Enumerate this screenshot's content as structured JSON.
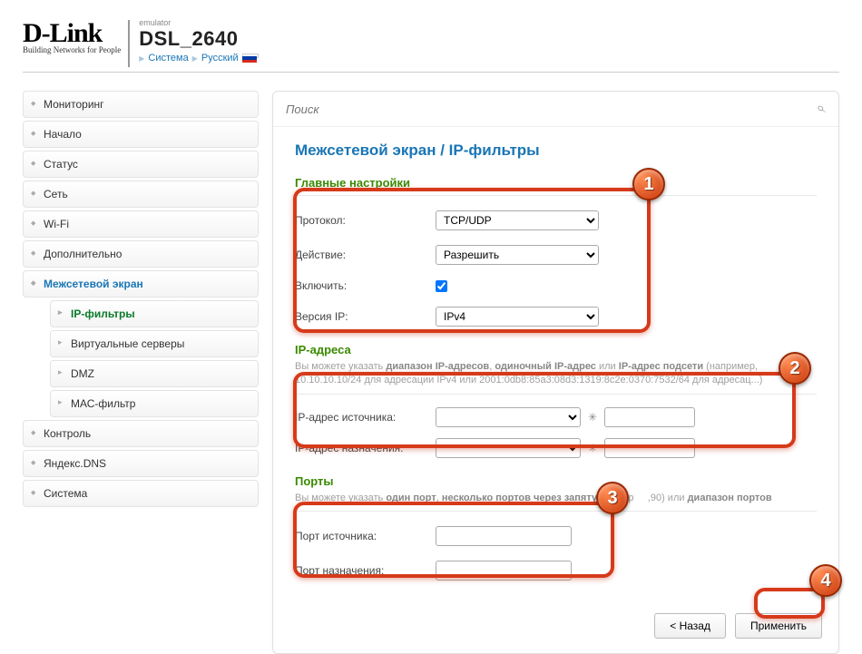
{
  "logo": {
    "brand": "D-Link",
    "tagline": "Building Networks for People"
  },
  "model": {
    "emulator": "emulator",
    "name": "DSL_2640",
    "menu_system": "Система",
    "menu_lang": "Русский"
  },
  "sidebar": {
    "items": [
      "Мониторинг",
      "Начало",
      "Статус",
      "Сеть",
      "Wi-Fi",
      "Дополнительно",
      "Межсетевой экран",
      "Контроль",
      "Яндекс.DNS",
      "Система"
    ],
    "firewall_sub": [
      "IP-фильтры",
      "Виртуальные серверы",
      "DMZ",
      "МАС-фильтр"
    ]
  },
  "search": {
    "placeholder": "Поиск"
  },
  "breadcrumb": "Межсетевой экран /  IP-фильтры",
  "sections": {
    "main": {
      "title": "Главные настройки",
      "protocol_label": "Протокол:",
      "protocol_value": "TCP/UDP",
      "action_label": "Действие:",
      "action_value": "Разрешить",
      "enable_label": "Включить:",
      "enable_checked": true,
      "ipver_label": "Версия IP:",
      "ipver_value": "IPv4"
    },
    "addr": {
      "title": "IP-адреса",
      "hint_pre": "Вы можете указать ",
      "hint_b1": "диапазон IP-адресов",
      "hint_mid1": ", ",
      "hint_b2": "одиночный IP-адрес",
      "hint_mid2": " или ",
      "hint_b3": "IP-адрес подсети",
      "hint_post": " (например, 10.10.10.10/24 для адресации IPv4 или 2001:0db8:85a3:08d3:1319:8c2e:0370:7532/64 для адресац...)",
      "src_label": "IP-адрес источника:",
      "dst_label": "IP-адрес назначения:"
    },
    "ports": {
      "title": "Порты",
      "hint_pre": "Вы можете указать ",
      "hint_b1": "один порт",
      "hint_mid1": ", ",
      "hint_b2": "несколько портов через запятую",
      "hint_mid2": " (напр",
      "hint_end": ",90) или ",
      "hint_b3": "диапазон портов",
      "src_label": "Порт источника:",
      "dst_label": "Порт назначения:"
    }
  },
  "buttons": {
    "back": "< Назад",
    "apply": "Применить"
  },
  "badges": [
    "1",
    "2",
    "3",
    "4"
  ]
}
